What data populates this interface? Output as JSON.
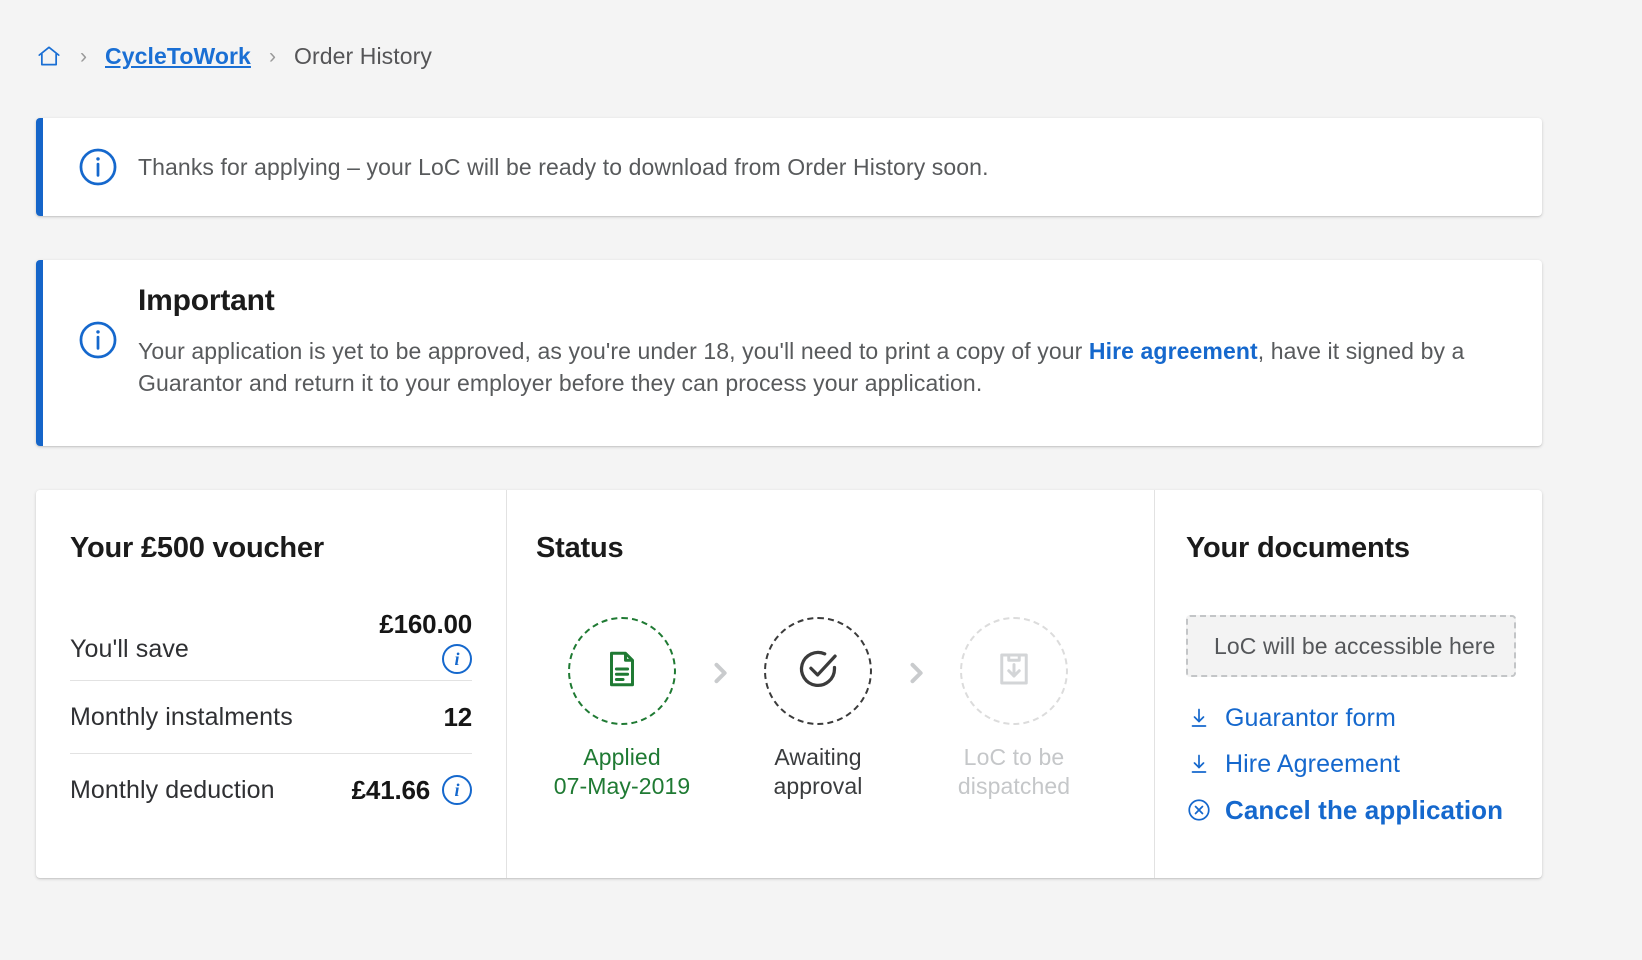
{
  "breadcrumb": {
    "home_icon": "home-icon",
    "separator": "›",
    "link_label": "CycleToWork",
    "current_label": "Order History"
  },
  "alerts": [
    {
      "icon": "info-circle-icon",
      "text": "Thanks for applying – your LoC will be ready to download from Order History soon.",
      "accent_color": "#1565c9"
    },
    {
      "icon": "info-circle-icon",
      "title": "Important",
      "text_before_link": "Your application is yet to be approved, as you're under 18, you'll need to print a copy of your ",
      "link_label": "Hire agreement",
      "text_after_link": ", have it signed by a Guarantor and return it to your employer before they can process your application.",
      "accent_color": "#1565c9"
    }
  ],
  "voucher": {
    "title": "Your £500 voucher",
    "rows": [
      {
        "label": "You'll save",
        "value": "£160.00",
        "info_icon": "info-icon",
        "has_info": true,
        "stacked": true
      },
      {
        "label": "Monthly instalments",
        "value": "12",
        "info_icon": "",
        "has_info": false,
        "stacked": false
      },
      {
        "label": "Monthly deduction",
        "value": "£41.66",
        "info_icon": "info-icon",
        "has_info": true,
        "stacked": false
      }
    ]
  },
  "status": {
    "title": "Status",
    "arrow_icon": "chevron-right-icon",
    "steps": [
      {
        "icon": "document-icon",
        "label_line1": "Applied",
        "label_line2": "07-May-2019",
        "state": "done",
        "color": "#1f7a33"
      },
      {
        "icon": "check-circle-icon",
        "label_line1": "Awaiting",
        "label_line2": "approval",
        "state": "current",
        "color": "#3a3c3e"
      },
      {
        "icon": "inbox-download-icon",
        "label_line1": "LoC to be",
        "label_line2": "dispatched",
        "state": "pending",
        "color": "#c5c7c9"
      }
    ]
  },
  "documents": {
    "title": "Your documents",
    "placeholder_text": "LoC will be accessible here",
    "links": [
      {
        "icon": "download-icon",
        "label": "Guarantor form",
        "strong": false
      },
      {
        "icon": "download-icon",
        "label": "Hire Agreement",
        "strong": false
      },
      {
        "icon": "cancel-circle-icon",
        "label": "Cancel the application",
        "strong": true
      }
    ]
  }
}
